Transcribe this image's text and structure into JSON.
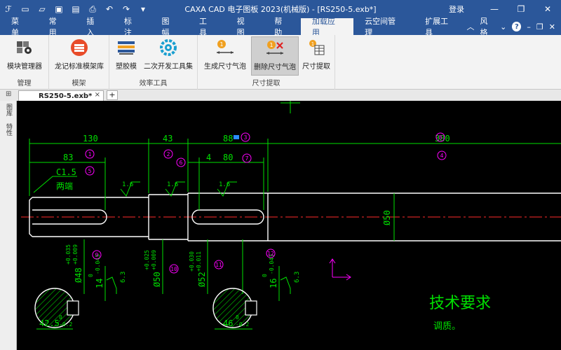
{
  "window": {
    "title": "CAXA CAD 电子图板 2023(机械版) - [RS250-5.exb*]",
    "login": "登录",
    "minimize": "—",
    "restore": "❐",
    "close": "✕"
  },
  "tabs": {
    "items": [
      "菜单",
      "常用",
      "插入",
      "标注",
      "图幅",
      "工具",
      "视图",
      "帮助",
      "加载应用",
      "云空间管理",
      "扩展工具"
    ],
    "active": "加载应用",
    "style_label": "风格",
    "help": "?"
  },
  "ribbon": {
    "groups": {
      "manage": "管理",
      "frame": "模架",
      "efficiency": "效率工具",
      "dimension_extract": "尺寸提取"
    },
    "buttons": {
      "module_manager": "模块管理器",
      "longji_frame": "龙记标准模架库",
      "plastic_mold": "塑胶模",
      "secondary_dev": "二次开发工具集",
      "gen_bubble": "生成尺寸气泡",
      "del_bubble": "删除尺寸气泡",
      "dim_extract": "尺寸提取"
    }
  },
  "doc": {
    "tab_name": "RS250-5.exb*",
    "close": "×",
    "add": "+"
  },
  "sidebar": {
    "panel1": "图库",
    "panel2": "特性"
  },
  "drawing": {
    "dims": {
      "d130": "130",
      "d43": "43",
      "d88": "88",
      "d380": "380",
      "d83": "83",
      "d4": "4",
      "d80": "80",
      "c15": "C1.5",
      "both_ends": "两端",
      "r16a": "1.6",
      "r16b": "1.6",
      "r16c": "1.6",
      "phi50": "Ø50",
      "phi48": "Ø48",
      "phi48_tol_up": "+0.035",
      "phi48_tol_dn": "+0.009",
      "w14": "14",
      "w14_tol_up": "0",
      "w14_tol_dn": "-0.043",
      "phi50b": "Ø50",
      "phi50b_tol_up": "+0.025",
      "phi50b_tol_dn": "+0.009",
      "phi52": "Ø52",
      "phi52_tol_up": "+0.030",
      "phi52_tol_dn": "+0.011",
      "w16": "16",
      "w16_tol_up": "0",
      "w16_tol_dn": "-0.043",
      "r63a": "6.3",
      "r63b": "6.3",
      "h425": "42.5",
      "h425_up": "0",
      "h425_dn": "-0.2",
      "h46": "46",
      "h46_up": "0",
      "h46_dn": "-0.2"
    },
    "bubbles": [
      "1",
      "2",
      "3",
      "4",
      "5",
      "6",
      "7",
      "8",
      "9",
      "10",
      "11",
      "12"
    ],
    "tech_title": "技术要求",
    "tech_note": "调质。"
  },
  "colors": {
    "accent": "#2b579a",
    "dim_green": "#00e000",
    "bubble_magenta": "#ff00ff",
    "outline_white": "#ffffff",
    "centerline_red": "#ff2a2a"
  }
}
